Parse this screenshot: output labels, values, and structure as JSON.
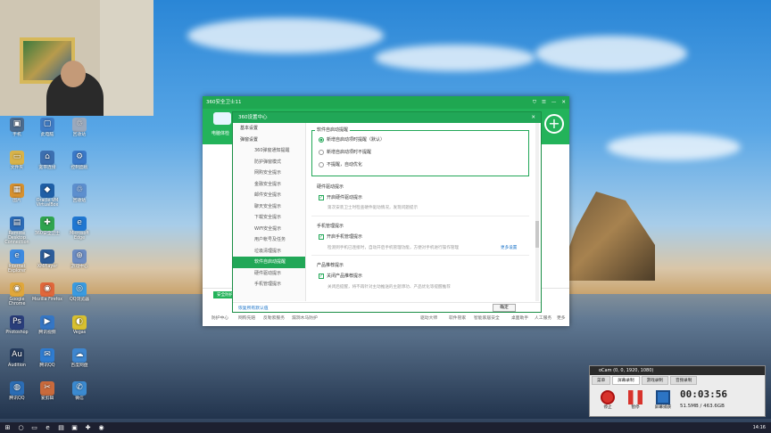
{
  "desktop_icons": [
    {
      "label": "手机",
      "color": "#4d6c8f",
      "glyph": "▣"
    },
    {
      "label": "此电脑",
      "color": "#3f7cc6",
      "glyph": "▢"
    },
    {
      "label": "回收站",
      "color": "#9aa9bd",
      "glyph": "♲"
    },
    {
      "label": "文件夹",
      "color": "#d8b34a",
      "glyph": "▭"
    },
    {
      "label": "宽带连接",
      "color": "#3c6fb0",
      "glyph": "⌂"
    },
    {
      "label": "控制面板",
      "color": "#3b79c8",
      "glyph": "⚙"
    },
    {
      "label": "图片",
      "color": "#d7912f",
      "glyph": "▦"
    },
    {
      "label": "Oracle VM VirtualBox",
      "color": "#1f5fa6",
      "glyph": "◆"
    },
    {
      "label": "回收站",
      "color": "#5d8fce",
      "glyph": "♲"
    },
    {
      "label": "Remote Desktop Connection",
      "color": "#2c6cb8",
      "glyph": "▤"
    },
    {
      "label": "360安全卫士",
      "color": "#2fa44f",
      "glyph": "✚"
    },
    {
      "label": "Microsoft Edge",
      "color": "#2077d1",
      "glyph": "e"
    },
    {
      "label": "Internet Explorer",
      "color": "#3d8ae0",
      "glyph": "e"
    },
    {
      "label": "XMPlayer",
      "color": "#2d5d9a",
      "glyph": "▶"
    },
    {
      "label": "游戏中心",
      "color": "#6c8cc2",
      "glyph": "⊕"
    },
    {
      "label": "Google Chrome",
      "color": "#e0a73b",
      "glyph": "◉"
    },
    {
      "label": "Mozilla Firefox",
      "color": "#e0673b",
      "glyph": "◉"
    },
    {
      "label": "QQ浏览器",
      "color": "#3b9be0",
      "glyph": "◎"
    },
    {
      "label": "Photoshop",
      "color": "#2a3e7b",
      "glyph": "Ps"
    },
    {
      "label": "腾讯视频",
      "color": "#3576c4",
      "glyph": "▶"
    },
    {
      "label": "Vegas",
      "color": "#d8c030",
      "glyph": "◐"
    },
    {
      "label": "Audition",
      "color": "#263c5e",
      "glyph": "Au"
    },
    {
      "label": "腾讯QQ",
      "color": "#2f7cd0",
      "glyph": "✉"
    },
    {
      "label": "百度网盘",
      "color": "#3e86cf",
      "glyph": "☁"
    },
    {
      "label": "腾讯QQ",
      "color": "#2b6db5",
      "glyph": "◍"
    },
    {
      "label": "爱剪辑",
      "color": "#c96a3c",
      "glyph": "✂"
    },
    {
      "label": "微信",
      "color": "#3b8ad0",
      "glyph": "✆"
    }
  ],
  "app": {
    "title": "360安全卫士11",
    "header_label": "电脑体检",
    "footer_safe": "安全防护中心",
    "footer_tabs": [
      "防护中心",
      "网购先赔",
      "反勒索服务",
      "漏洞木马防护",
      "驱动大师",
      "软件管家",
      "智能家居安全",
      "桌面助手",
      "人工服务",
      "更多"
    ]
  },
  "dialog": {
    "title": "360设置中心",
    "sidebar": [
      {
        "label": "基本设置",
        "top": true,
        "active": false
      },
      {
        "label": "弹窗设置",
        "top": true,
        "active": false
      },
      {
        "label": "360弹窗通知提醒",
        "top": false,
        "active": false
      },
      {
        "label": "防护弹窗模式",
        "top": false,
        "active": false
      },
      {
        "label": "网购安全提示",
        "top": false,
        "active": false
      },
      {
        "label": "金融安全提示",
        "top": false,
        "active": false
      },
      {
        "label": "邮件安全提示",
        "top": false,
        "active": false
      },
      {
        "label": "聊天安全提示",
        "top": false,
        "active": false
      },
      {
        "label": "下载安全提示",
        "top": false,
        "active": false
      },
      {
        "label": "WiFi安全提示",
        "top": false,
        "active": false
      },
      {
        "label": "用户帐号及任务",
        "top": false,
        "active": false
      },
      {
        "label": "垃圾清理提示",
        "top": false,
        "active": false
      },
      {
        "label": "软件自启动提醒",
        "top": false,
        "active": true
      },
      {
        "label": "硬件驱动提示",
        "top": false,
        "active": false
      },
      {
        "label": "手机管理提示",
        "top": false,
        "active": false
      }
    ],
    "group_startup": {
      "title": "软件自启动提醒",
      "options": [
        {
          "label": "新增自启动项时提醒（默认）",
          "checked": true
        },
        {
          "label": "新增自启动项时不提醒",
          "checked": false
        },
        {
          "label": "不提醒，自动优化",
          "checked": false
        }
      ]
    },
    "section_driver": {
      "title": "硬件驱动提示",
      "check_label": "开启硬件驱动提示",
      "desc": "第次安装卫士时检查硬件驱动情况，发现问题提示"
    },
    "section_phone": {
      "title": "手机管理提示",
      "check_label": "开启手机管理提示",
      "desc": "检测到手机已连接时，自动开启手机管理功能，方便对手机进行操作管理",
      "link": "更多设置"
    },
    "section_product": {
      "title": "产品推荐提示",
      "check_label": "关闭产品推荐提示",
      "desc": "关闭后提醒，将不再针对主动推送的主题添功、产品优化等提醒推荐"
    },
    "restore_label": "恢复所有默认值",
    "ok_label": "确定"
  },
  "ucam": {
    "title": "oCam (0, 0, 1920, 1080)",
    "tabs": [
      "菜单",
      "屏幕录制",
      "游戏录制",
      "音频录制"
    ],
    "active_tab": 1,
    "buttons": [
      "停止",
      "暂停",
      "屏幕捕获"
    ],
    "timer": "00:03:56",
    "size": "51.5MB / 463.6GB"
  },
  "taskbar": {
    "time": "14:16"
  }
}
